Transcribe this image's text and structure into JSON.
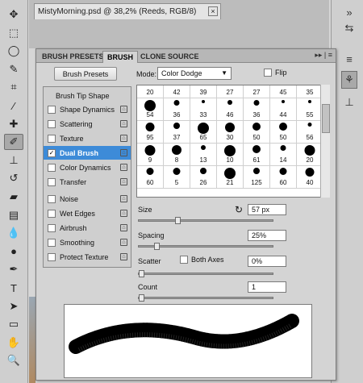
{
  "document": {
    "tab_title": "MistyMorning.psd @ 38,2% (Reeds, RGB/8)",
    "close_glyph": "×"
  },
  "toolbar": {
    "tools": [
      {
        "name": "move-icon",
        "glyph": "✥"
      },
      {
        "name": "marquee-icon",
        "glyph": "⬚"
      },
      {
        "name": "lasso-icon",
        "glyph": "◯"
      },
      {
        "name": "quick-select-icon",
        "glyph": "✎"
      },
      {
        "name": "crop-icon",
        "glyph": "⌗"
      },
      {
        "name": "eyedropper-icon",
        "glyph": "⁄"
      },
      {
        "name": "healing-brush-icon",
        "glyph": "✚"
      },
      {
        "name": "brush-icon",
        "glyph": "✐",
        "active": true
      },
      {
        "name": "stamp-icon",
        "glyph": "⊥"
      },
      {
        "name": "history-brush-icon",
        "glyph": "↺"
      },
      {
        "name": "eraser-icon",
        "glyph": "▰"
      },
      {
        "name": "gradient-icon",
        "glyph": "▤"
      },
      {
        "name": "blur-icon",
        "glyph": "💧"
      },
      {
        "name": "dodge-icon",
        "glyph": "●"
      },
      {
        "name": "pen-icon",
        "glyph": "✒"
      },
      {
        "name": "type-icon",
        "glyph": "T"
      },
      {
        "name": "path-select-icon",
        "glyph": "➤"
      },
      {
        "name": "shape-icon",
        "glyph": "▭"
      },
      {
        "name": "hand-icon",
        "glyph": "✋"
      },
      {
        "name": "zoom-icon",
        "glyph": "🔍"
      }
    ]
  },
  "dock": {
    "buttons": [
      {
        "name": "collapse-dock-icon",
        "glyph": "»"
      },
      {
        "name": "history-panel-icon",
        "glyph": "⇆"
      },
      {
        "name": "brush-presets-icon",
        "glyph": "≡"
      },
      {
        "name": "brush-panel-icon",
        "glyph": "⚘",
        "active": true
      },
      {
        "name": "clone-source-icon",
        "glyph": "⊥"
      }
    ]
  },
  "panel": {
    "tabs": [
      "BRUSH PRESETS",
      "BRUSH",
      "CLONE SOURCE"
    ],
    "active_tab": 1,
    "menu_glyph": "▸▸ | ≡",
    "brush_presets_button": "Brush Presets",
    "mode_label": "Mode:",
    "mode_value": "Color Dodge",
    "flip_label": "Flip",
    "list": [
      {
        "label": "Brush Tip Shape",
        "header": true
      },
      {
        "label": "Shape Dynamics",
        "checked": false,
        "lock": true
      },
      {
        "label": "Scattering",
        "checked": false,
        "lock": true
      },
      {
        "label": "Texture",
        "checked": false,
        "lock": true
      },
      {
        "label": "Dual Brush",
        "checked": true,
        "lock": true,
        "selected": true
      },
      {
        "label": "Color Dynamics",
        "checked": false,
        "lock": true
      },
      {
        "label": "Transfer",
        "checked": false,
        "lock": true
      },
      {
        "label": "Noise",
        "checked": false,
        "lock": true
      },
      {
        "label": "Wet Edges",
        "checked": false,
        "lock": true
      },
      {
        "label": "Airbrush",
        "checked": false,
        "lock": true
      },
      {
        "label": "Smoothing",
        "checked": false,
        "lock": true
      },
      {
        "label": "Protect Texture",
        "checked": false,
        "lock": true
      }
    ],
    "brush_grid": [
      [
        "20",
        "42",
        "39",
        "27",
        "27",
        "45",
        "35"
      ],
      [
        "54",
        "36",
        "33",
        "46",
        "36",
        "44",
        "55"
      ],
      [
        "95",
        "37",
        "65",
        "30",
        "50",
        "50",
        "56"
      ],
      [
        "9",
        "8",
        "13",
        "10",
        "61",
        "14",
        "20"
      ],
      [
        "60",
        "5",
        "26",
        "21",
        "125",
        "60",
        "40"
      ]
    ],
    "size_label": "Size",
    "size_value": "57 px",
    "size_level": 0.28,
    "spacing_label": "Spacing",
    "spacing_value": "25%",
    "spacing_level": 0.12,
    "scatter_label": "Scatter",
    "both_axes_label": "Both Axes",
    "scatter_value": "0%",
    "scatter_level": 0.0,
    "count_label": "Count",
    "count_value": "1",
    "count_level": 0.0
  }
}
